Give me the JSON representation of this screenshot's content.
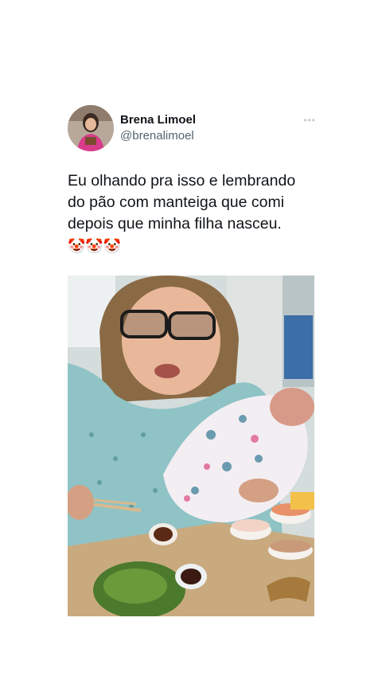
{
  "tweet": {
    "display_name": "Brena Limoel",
    "handle": "@brenalimoel",
    "more": "•••",
    "text": "Eu olhando pra isso e lembrando\ndo pão com manteiga que comi\ndepois que minha filha nasceu.",
    "emojis": "🤡🤡🤡"
  },
  "icons": {
    "more": "more-options-icon"
  },
  "colors": {
    "background": "#ffffff",
    "text": "#0f1419",
    "secondary": "#536471"
  }
}
